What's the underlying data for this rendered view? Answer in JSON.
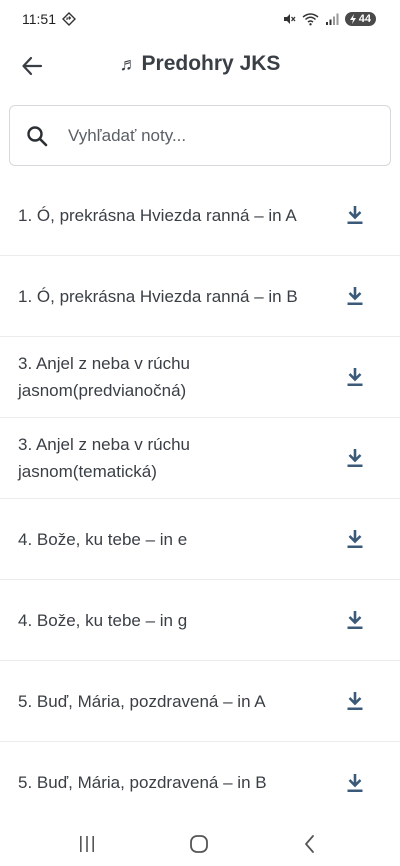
{
  "status_bar": {
    "time": "11:51",
    "battery": "44"
  },
  "app_bar": {
    "title_icon": "♬",
    "title": "Predohry JKS"
  },
  "search": {
    "placeholder": "Vyhľadať noty..."
  },
  "items": [
    {
      "label": "1. Ó, prekrásna Hviezda ranná – in A"
    },
    {
      "label": "1. Ó, prekrásna Hviezda ranná – in B"
    },
    {
      "label": "3. Anjel z neba v rúchu jasnom(predvianočná)"
    },
    {
      "label": "3. Anjel z neba v rúchu jasnom(tematická)"
    },
    {
      "label": "4. Bože, ku tebe – in e"
    },
    {
      "label": "4. Bože, ku tebe – in g"
    },
    {
      "label": "5. Buď, Mária, pozdravená – in A"
    },
    {
      "label": "5. Buď, Mária, pozdravená – in B"
    }
  ],
  "colors": {
    "accent": "#3b5a7a",
    "text": "#3a3f45",
    "divider": "#ececec"
  },
  "icons": {
    "back": "arrow-left-icon",
    "search": "search-icon",
    "download": "download-icon"
  }
}
